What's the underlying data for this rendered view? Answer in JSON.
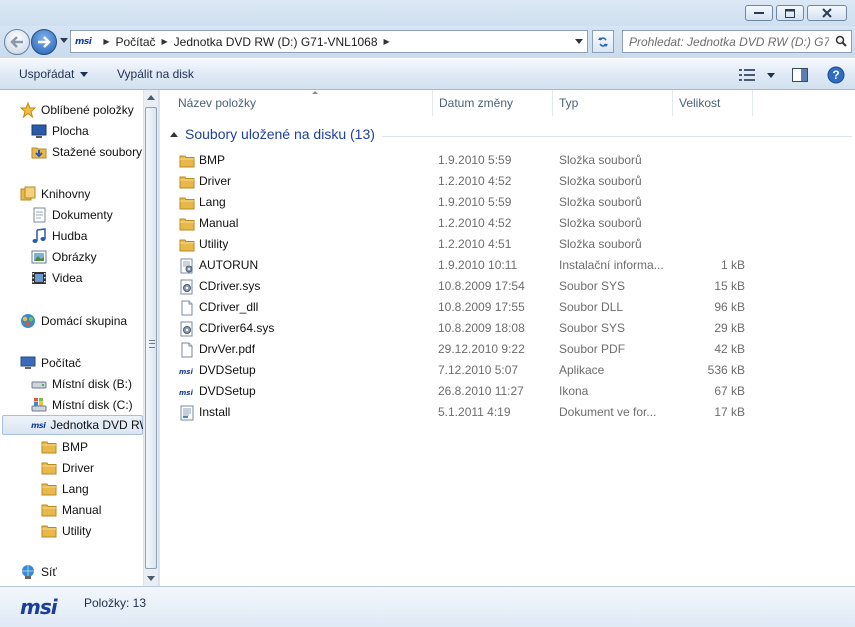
{
  "address": {
    "crumbs": [
      "Počítač",
      "Jednotka DVD RW (D:) G71-VNL1068"
    ],
    "brand": "msi"
  },
  "search": {
    "placeholder": "Prohledat: Jednotka DVD RW (D:) G7..."
  },
  "toolbar": {
    "organize_label": "Uspořádat",
    "burn_label": "Vypálit na disk"
  },
  "nav": {
    "favorites": {
      "label": "Oblíbené položky",
      "items": [
        "Plocha",
        "Stažené soubory"
      ]
    },
    "libraries": {
      "label": "Knihovny",
      "items": [
        "Dokumenty",
        "Hudba",
        "Obrázky",
        "Videa"
      ]
    },
    "homegroup": {
      "label": "Domácí skupina"
    },
    "computer": {
      "label": "Počítač",
      "items": [
        "Místní disk  (B:)",
        "Místní disk (C:)",
        "Jednotka DVD RW"
      ],
      "subfolders": [
        "BMP",
        "Driver",
        "Lang",
        "Manual",
        "Utility"
      ]
    },
    "network": {
      "label": "Síť"
    }
  },
  "columns": {
    "name": "Název položky",
    "date": "Datum změny",
    "type": "Typ",
    "size": "Velikost"
  },
  "group": {
    "label": "Soubory uložené na disku (13)"
  },
  "files": [
    {
      "name": "BMP",
      "date": "1.9.2010 5:59",
      "type": "Složka souborů",
      "size": "",
      "icon": "folder-icon"
    },
    {
      "name": "Driver",
      "date": "1.2.2010 4:52",
      "type": "Složka souborů",
      "size": "",
      "icon": "folder-icon"
    },
    {
      "name": "Lang",
      "date": "1.9.2010 5:59",
      "type": "Složka souborů",
      "size": "",
      "icon": "folder-icon"
    },
    {
      "name": "Manual",
      "date": "1.2.2010 4:52",
      "type": "Složka souborů",
      "size": "",
      "icon": "folder-icon"
    },
    {
      "name": "Utility",
      "date": "1.2.2010 4:51",
      "type": "Složka souborů",
      "size": "",
      "icon": "folder-icon"
    },
    {
      "name": "AUTORUN",
      "date": "1.9.2010 10:11",
      "type": "Instalační informa...",
      "size": "1 kB",
      "icon": "setup-info-icon"
    },
    {
      "name": "CDriver.sys",
      "date": "10.8.2009 17:54",
      "type": "Soubor SYS",
      "size": "15 kB",
      "icon": "system-file-icon"
    },
    {
      "name": "CDriver_dll",
      "date": "10.8.2009 17:55",
      "type": "Soubor DLL",
      "size": "96 kB",
      "icon": "blank-file-icon"
    },
    {
      "name": "CDriver64.sys",
      "date": "10.8.2009 18:08",
      "type": "Soubor SYS",
      "size": "29 kB",
      "icon": "system-file-icon"
    },
    {
      "name": "DrvVer.pdf",
      "date": "29.12.2010 9:22",
      "type": "Soubor PDF",
      "size": "42 kB",
      "icon": "blank-file-icon"
    },
    {
      "name": "DVDSetup",
      "date": "7.12.2010 5:07",
      "type": "Aplikace",
      "size": "536 kB",
      "icon": "msi-app-icon"
    },
    {
      "name": "DVDSetup",
      "date": "26.8.2010 11:27",
      "type": "Ikona",
      "size": "67 kB",
      "icon": "msi-app-icon"
    },
    {
      "name": "Install",
      "date": "5.1.2011 4:19",
      "type": "Dokument ve for...",
      "size": "17 kB",
      "icon": "document-icon"
    }
  ],
  "status": {
    "logo": "msi",
    "items_label": "Položky: 13"
  },
  "colors": {
    "accent": "#1e3fa0",
    "folder": "#e8b84a",
    "selection": "#d9e5f3"
  }
}
